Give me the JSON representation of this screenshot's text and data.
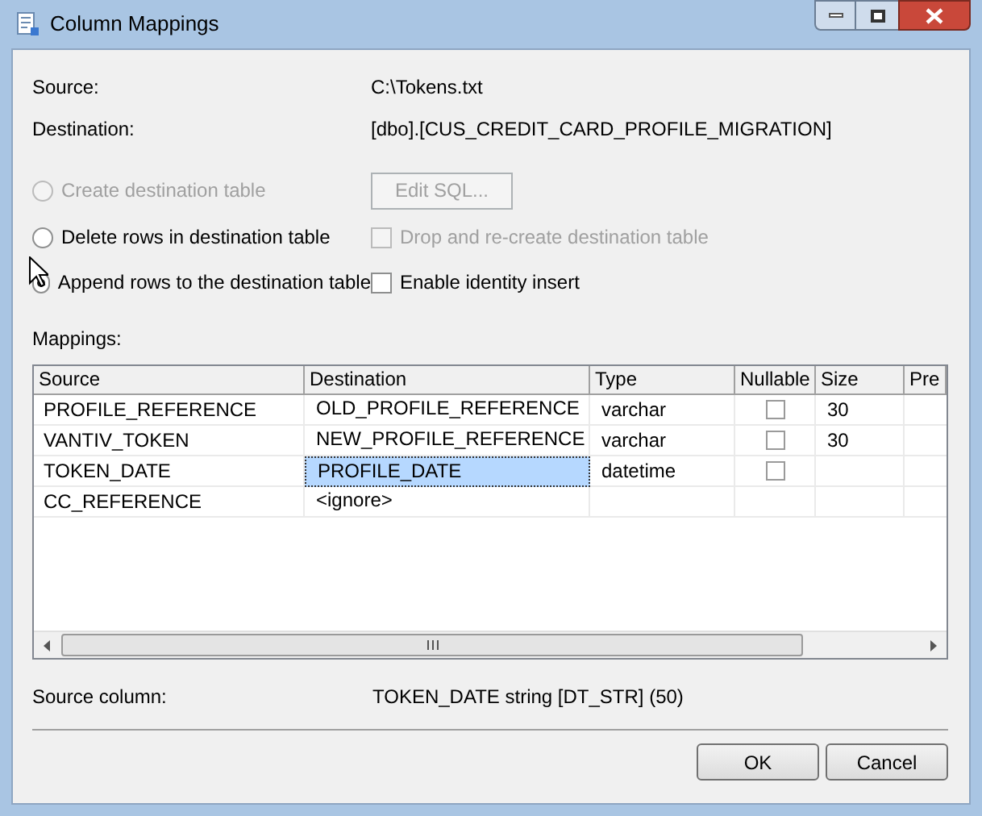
{
  "window": {
    "title": "Column Mappings"
  },
  "info": [
    {
      "label": "Source:",
      "value": "C:\\Tokens.txt"
    },
    {
      "label": "Destination:",
      "value": "[dbo].[CUS_CREDIT_CARD_PROFILE_MIGRATION]"
    }
  ],
  "options": [
    {
      "radio": {
        "label": "Create destination table",
        "selected": false,
        "disabled": true
      },
      "button": {
        "label": "Edit SQL...",
        "disabled": true
      }
    },
    {
      "radio": {
        "label": "Delete rows in destination table",
        "selected": false,
        "disabled": false
      },
      "checkbox": {
        "label": "Drop and re-create destination table",
        "checked": false,
        "disabled": true
      }
    },
    {
      "radio": {
        "label": "Append rows to the destination table",
        "selected": true,
        "disabled": false
      },
      "checkbox": {
        "label": "Enable identity insert",
        "checked": false,
        "disabled": false
      }
    }
  ],
  "mappings_label": "Mappings:",
  "table": {
    "columns": [
      "Source",
      "Destination",
      "Type",
      "Nullable",
      "Size",
      "Pre"
    ],
    "rows": [
      {
        "source": "PROFILE_REFERENCE",
        "destination": "OLD_PROFILE_REFERENCE",
        "type": "varchar",
        "nullable": false,
        "size": "30",
        "selected": false
      },
      {
        "source": "VANTIV_TOKEN",
        "destination": "NEW_PROFILE_REFERENCE",
        "type": "varchar",
        "nullable": false,
        "size": "30",
        "selected": false
      },
      {
        "source": "TOKEN_DATE",
        "destination": "PROFILE_DATE",
        "type": "datetime",
        "nullable": false,
        "selected": true
      },
      {
        "source": "CC_REFERENCE",
        "destination": "<ignore>",
        "selected": false
      }
    ]
  },
  "source_column": {
    "label": "Source column:",
    "value": "TOKEN_DATE string [DT_STR] (50)"
  },
  "buttons": [
    "OK",
    "Cancel"
  ]
}
